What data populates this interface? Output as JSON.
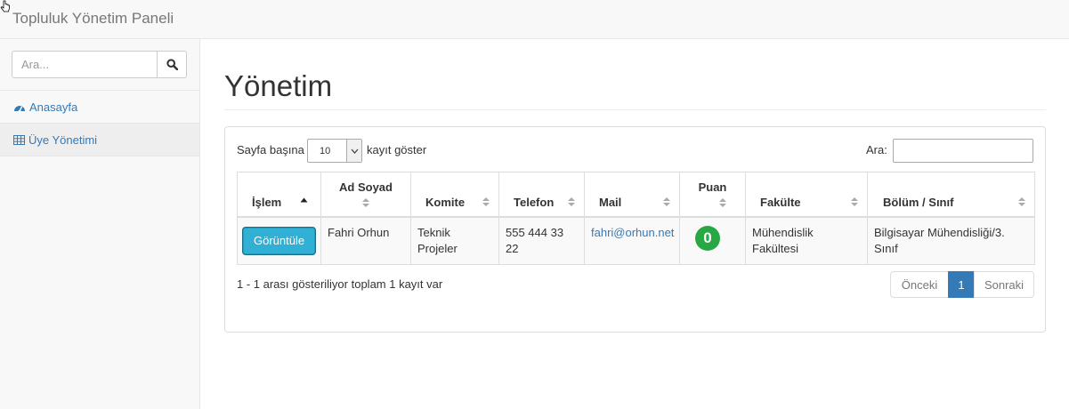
{
  "app": {
    "title": "Topluluk Yönetim Paneli"
  },
  "sidebar": {
    "search_placeholder": "Ara...",
    "items": [
      {
        "label": "Anasayfa",
        "icon": "dashboard-icon",
        "active": false
      },
      {
        "label": "Üye Yönetimi",
        "icon": "table-icon",
        "active": true
      }
    ]
  },
  "main": {
    "title": "Yönetim",
    "length": {
      "prefix": "Sayfa başına",
      "value": "10",
      "suffix": "kayıt göster"
    },
    "filter_label": "Ara:",
    "filter_value": "",
    "columns": [
      "İşlem",
      "Ad Soyad",
      "Komite",
      "Telefon",
      "Mail",
      "Puan",
      "Fakülte",
      "Bölüm / Sınıf"
    ],
    "rows": [
      {
        "action": "Görüntüle",
        "name": "Fahri Orhun",
        "committee": "Teknik Projeler",
        "phone": "555 444 33 22",
        "mail": "fahri@orhun.net",
        "score": "0",
        "faculty": "Mühendislik Fakültesi",
        "department": "Bilgisayar Mühendisliği/3. Sınıf"
      }
    ],
    "info": "1 - 1 arası gösteriliyor toplam 1 kayıt var",
    "pagination": {
      "prev": "Önceki",
      "current": "1",
      "next": "Sonraki"
    }
  },
  "colors": {
    "accent": "#337ab7",
    "info_button": "#31b0d5",
    "score_badge": "#28a745"
  }
}
